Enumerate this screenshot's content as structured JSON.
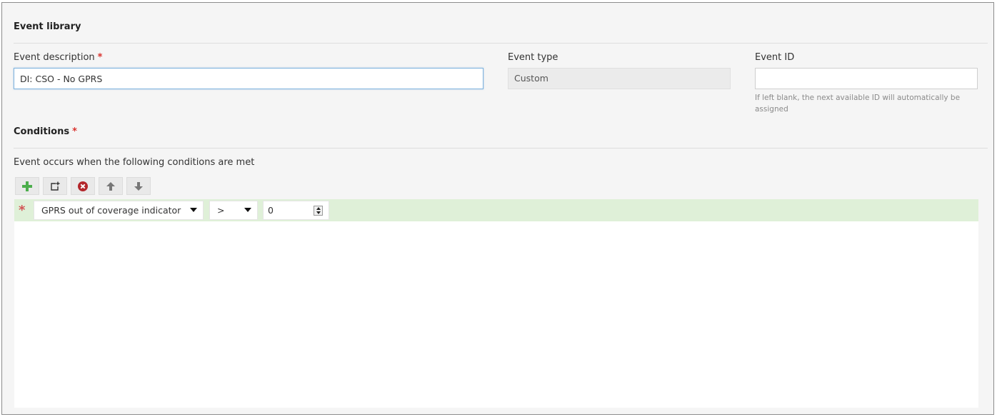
{
  "event_library": {
    "title": "Event library",
    "description_label": "Event description",
    "required_mark": "*",
    "description_value": "DI: CSO - No GPRS",
    "type_label": "Event type",
    "type_value": "Custom",
    "id_label": "Event ID",
    "id_value": "",
    "id_help": "If left blank, the next available ID will automatically be assigned"
  },
  "conditions": {
    "title": "Conditions",
    "required_mark": "*",
    "intro": "Event occurs when the following conditions are met",
    "toolbar": [
      {
        "name": "add-condition-button",
        "icon": "plus-icon"
      },
      {
        "name": "add-group-button",
        "icon": "new-group-icon"
      },
      {
        "name": "remove-condition-button",
        "icon": "remove-circle-icon"
      },
      {
        "name": "move-up-button",
        "icon": "arrow-up-icon"
      },
      {
        "name": "move-down-button",
        "icon": "arrow-down-icon"
      }
    ],
    "rows": [
      {
        "marker": "*",
        "field": "GPRS out of coverage indicator",
        "operator": ">",
        "value": "0"
      }
    ]
  },
  "colors": {
    "accent_required": "#d9332e",
    "row_highlight": "#dff0d8",
    "add_green": "#4cae4c",
    "remove_red": "#b3262b"
  }
}
